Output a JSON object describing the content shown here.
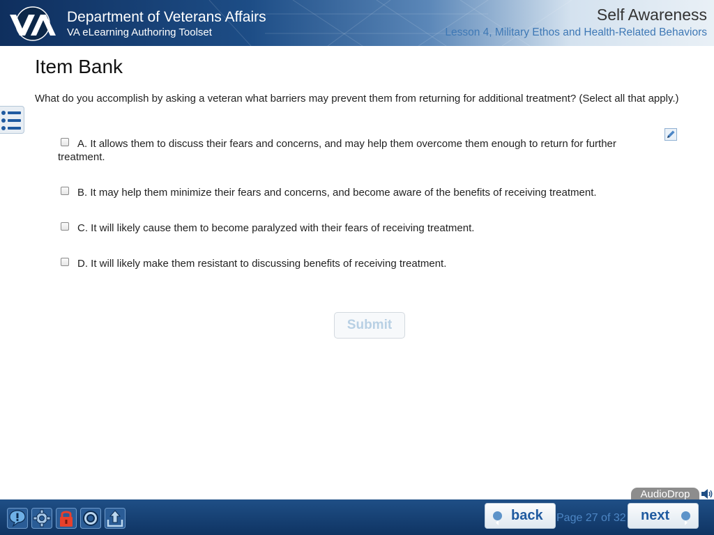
{
  "header": {
    "org_title": "Department of Veterans Affairs",
    "org_subtitle": "VA eLearning Authoring Toolset",
    "course_title": "Self Awareness",
    "lesson_title": "Lesson 4, Military Ethos and Health-Related Behaviors",
    "logo_icon": "va-logo-icon"
  },
  "main": {
    "page_title": "Item Bank",
    "question": "What do you accomplish by asking a veteran what barriers may prevent them from returning for additional treatment? (Select all that apply.)",
    "options": [
      {
        "label": "A. It allows them to discuss their fears and concerns, and may help them overcome them enough to return for further treatment.",
        "checked": false
      },
      {
        "label": "B. It may help them minimize their fears and concerns, and become aware of the benefits of receiving treatment.",
        "checked": false
      },
      {
        "label": "C. It will likely cause them to become paralyzed with their fears of receiving treatment.",
        "checked": false
      },
      {
        "label": "D. It will likely make them resistant to discussing benefits of receiving treatment.",
        "checked": false
      }
    ],
    "submit_label": "Submit"
  },
  "audio": {
    "label": "AudioDrop"
  },
  "footer": {
    "tools": [
      "help-icon",
      "settings-icon",
      "lock-icon",
      "target-icon",
      "upload-icon"
    ],
    "back_label": "back",
    "next_label": "next",
    "page_indicator": "Page 27 of 32"
  },
  "colors": {
    "header_dark": "#0f2f5e",
    "accent_blue": "#3e78b5",
    "footer_bg": "#143e71",
    "nav_text": "#1f5aa0"
  }
}
